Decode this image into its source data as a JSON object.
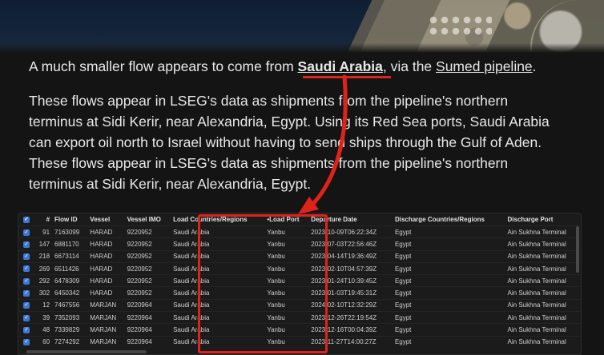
{
  "article": {
    "p1_before": "A much smaller flow appears to come from ",
    "p1_bold": "Saudi Arabia",
    "p1_mid": ", via the ",
    "p1_link": "Sumed pipeline",
    "p1_end": ".",
    "p2_line1": "These flows appear in LSEG's data as shipments from the pipeline's northern",
    "p2_line2": "terminus at Sidi Kerir, near Alexandria, Egypt. Using its Red Sea ports, Saudi Arabia",
    "p2_line3": "can export oil north to Israel without having to send ships through the Gulf of Aden.",
    "p2_line4": "These flows appear in LSEG's data as shipments from the pipeline's northern",
    "p2_line5": "terminus at Sidi Kerir, near Alexandria, Egypt."
  },
  "table": {
    "headers": {
      "num": "#",
      "flow_id": "Flow ID",
      "vessel": "Vessel",
      "imo": "Vessel IMO",
      "load_countries": "Load Countries/Regions",
      "load_port": "•Load Port",
      "departure": "Departure Date",
      "discharge_countries": "Discharge Countries/Regions",
      "discharge_port": "Discharge Port"
    },
    "rows": [
      {
        "num": "91",
        "flow": "7163099",
        "vessel": "HARAD",
        "imo": "9220952",
        "lc": "Saudi Arabia",
        "lp": "Yanbu",
        "dep": "2023-10-09T06:22:34Z",
        "dc": "Egypt",
        "dp": "Ain Sukhna Terminal"
      },
      {
        "num": "147",
        "flow": "6881170",
        "vessel": "HARAD",
        "imo": "9220952",
        "lc": "Saudi Arabia",
        "lp": "Yanbu",
        "dep": "2023-07-03T22:56:46Z",
        "dc": "Egypt",
        "dp": "Ain Sukhna Terminal"
      },
      {
        "num": "218",
        "flow": "6673114",
        "vessel": "HARAD",
        "imo": "9220952",
        "lc": "Saudi Arabia",
        "lp": "Yanbu",
        "dep": "2023-04-14T19:36:49Z",
        "dc": "Egypt",
        "dp": "Ain Sukhna Terminal"
      },
      {
        "num": "269",
        "flow": "6511426",
        "vessel": "HARAD",
        "imo": "9220952",
        "lc": "Saudi Arabia",
        "lp": "Yanbu",
        "dep": "2023-02-10T04:57:39Z",
        "dc": "Egypt",
        "dp": "Ain Sukhna Terminal"
      },
      {
        "num": "292",
        "flow": "6478309",
        "vessel": "HARAD",
        "imo": "9220952",
        "lc": "Saudi Arabia",
        "lp": "Yanbu",
        "dep": "2023-01-24T10:39:45Z",
        "dc": "Egypt",
        "dp": "Ain Sukhna Terminal"
      },
      {
        "num": "302",
        "flow": "6450342",
        "vessel": "HARAD",
        "imo": "9220952",
        "lc": "Saudi Arabia",
        "lp": "Yanbu",
        "dep": "2023-01-03T19:45:31Z",
        "dc": "Egypt",
        "dp": "Ain Sukhna Terminal"
      },
      {
        "num": "12",
        "flow": "7467556",
        "vessel": "MARJAN",
        "imo": "9220964",
        "lc": "Saudi Arabia",
        "lp": "Yanbu",
        "dep": "2024-02-10T12:32:29Z",
        "dc": "Egypt",
        "dp": "Ain Sukhna Terminal"
      },
      {
        "num": "39",
        "flow": "7352093",
        "vessel": "MARJAN",
        "imo": "9220964",
        "lc": "Saudi Arabia",
        "lp": "Yanbu",
        "dep": "2023-12-26T22:19:54Z",
        "dc": "Egypt",
        "dp": "Ain Sukhna Terminal"
      },
      {
        "num": "48",
        "flow": "7339829",
        "vessel": "MARJAN",
        "imo": "9220964",
        "lc": "Saudi Arabia",
        "lp": "Yanbu",
        "dep": "2023-12-16T00:04:39Z",
        "dc": "Egypt",
        "dp": "Ain Sukhna Terminal"
      },
      {
        "num": "60",
        "flow": "7274292",
        "vessel": "MARJAN",
        "imo": "9220964",
        "lc": "Saudi Arabia",
        "lp": "Yanbu",
        "dep": "2023-11-27T14:00:27Z",
        "dc": "Egypt",
        "dp": "Ain Sukhna Terminal"
      }
    ]
  },
  "colors": {
    "highlight": "#e0231a",
    "checkbox": "#3b79d8"
  },
  "icons": {
    "checkbox": "checkbox-checked-icon"
  }
}
